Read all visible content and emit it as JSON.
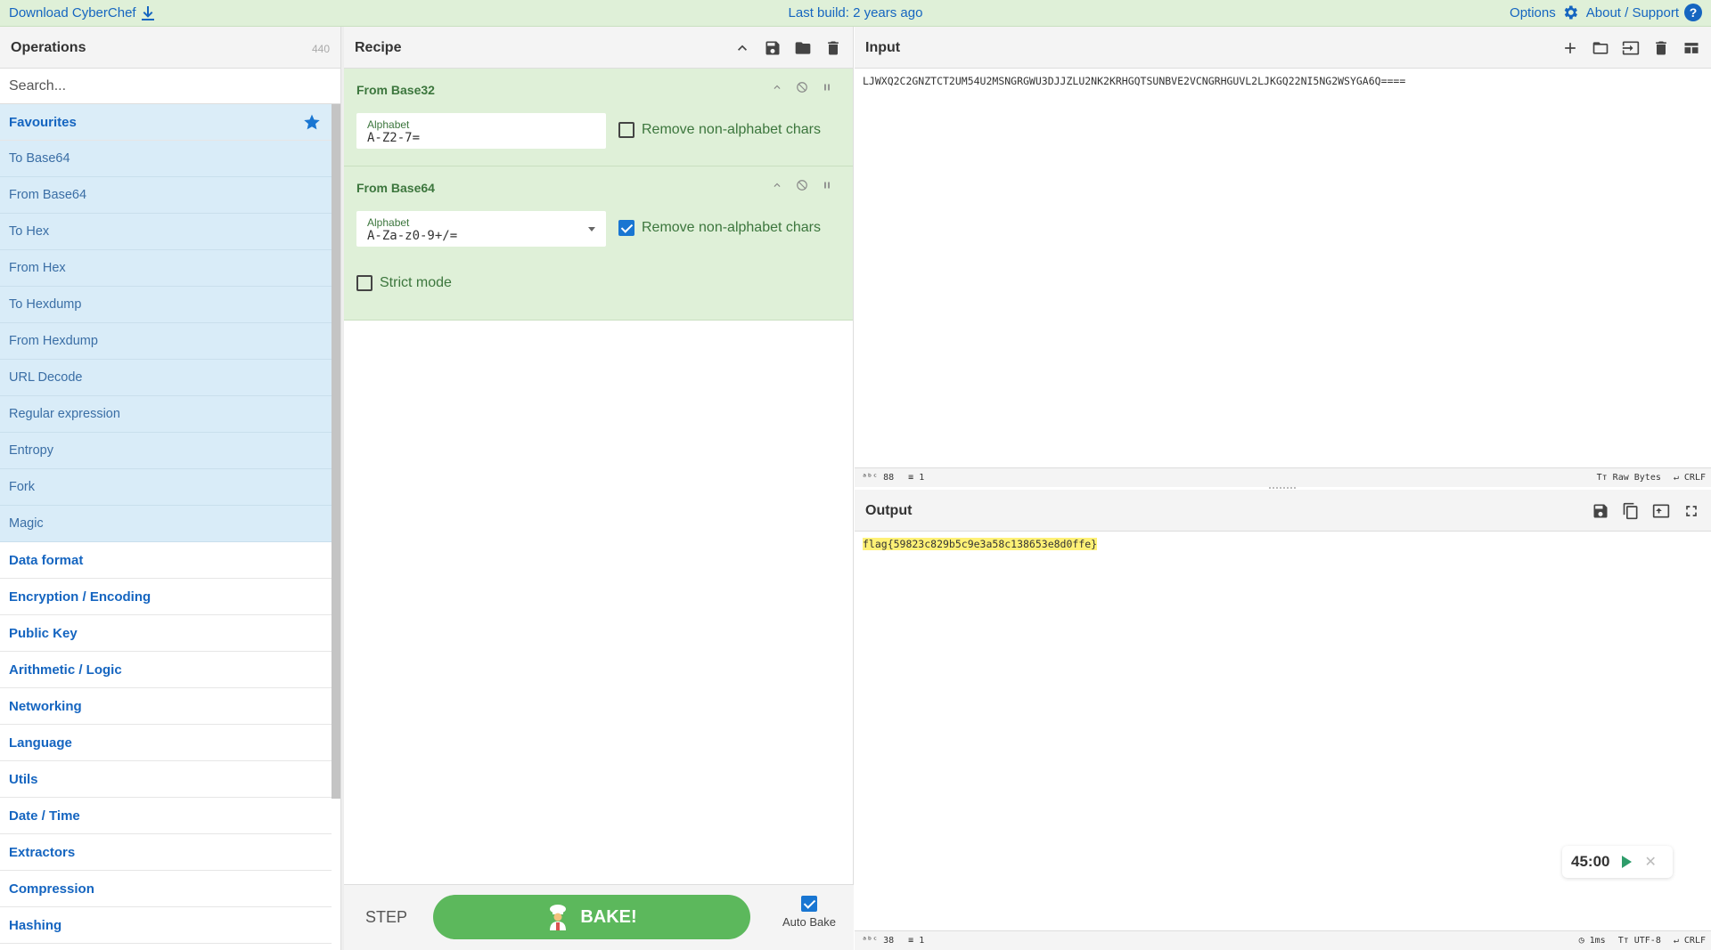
{
  "banner": {
    "download_label": "Download CyberChef",
    "build_label": "Last build: 2 years ago",
    "options_label": "Options",
    "about_label": "About / Support",
    "help_glyph": "?"
  },
  "operations": {
    "title": "Operations",
    "count": "440",
    "search_placeholder": "Search...",
    "favourites_label": "Favourites",
    "favourites": [
      "To Base64",
      "From Base64",
      "To Hex",
      "From Hex",
      "To Hexdump",
      "From Hexdump",
      "URL Decode",
      "Regular expression",
      "Entropy",
      "Fork",
      "Magic"
    ],
    "categories": [
      "Data format",
      "Encryption / Encoding",
      "Public Key",
      "Arithmetic / Logic",
      "Networking",
      "Language",
      "Utils",
      "Date / Time",
      "Extractors",
      "Compression",
      "Hashing"
    ]
  },
  "recipe": {
    "title": "Recipe",
    "ops": [
      {
        "name": "From Base32",
        "alphabet_label": "Alphabet",
        "alphabet_value": "A-Z2-7=",
        "remove_label": "Remove non-alphabet chars",
        "remove_checked": false
      },
      {
        "name": "From Base64",
        "alphabet_label": "Alphabet",
        "alphabet_value": "A-Za-z0-9+/=",
        "remove_label": "Remove non-alphabet chars",
        "remove_checked": true,
        "strict_label": "Strict mode",
        "strict_checked": false
      }
    ],
    "step_label": "STEP",
    "bake_label": "BAKE!",
    "auto_bake_label": "Auto Bake",
    "auto_bake_checked": true
  },
  "input": {
    "title": "Input",
    "text": "LJWXQ2C2GNZTCT2UM54U2MSNGRGWU3DJJZLU2NK2KRHGQTSUNBVE2VCNGRHGUVL2LJKGQ22NI5NG2WSYGA6Q====",
    "status_chars": "88",
    "status_lines": "1",
    "encoding": "Raw Bytes",
    "eol": "CRLF"
  },
  "output": {
    "title": "Output",
    "text": "flag{59823c829b5c9e3a58c138653e8d0ffe}",
    "status_chars": "38",
    "status_lines": "1",
    "time": "1ms",
    "encoding": "UTF-8",
    "eol": "CRLF"
  },
  "timer": {
    "value": "45:00",
    "close_glyph": "✕"
  },
  "colors": {
    "accent": "#1565c0",
    "recipe_bg": "#dff0d8",
    "bake_green": "#5cb85c",
    "highlight": "#fff176"
  }
}
